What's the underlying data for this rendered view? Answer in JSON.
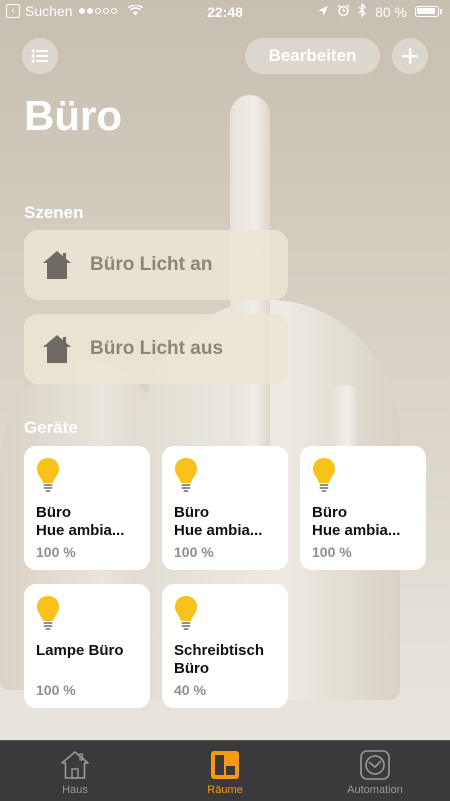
{
  "status_bar": {
    "back_label": "Suchen",
    "time": "22:48",
    "battery": "80 %"
  },
  "header": {
    "edit_label": "Bearbeiten",
    "title": "Büro"
  },
  "scenes": {
    "title": "Szenen",
    "items": [
      {
        "label": "Büro Licht an"
      },
      {
        "label": "Büro Licht aus"
      }
    ]
  },
  "devices": {
    "title": "Geräte",
    "items": [
      {
        "line1": "Büro",
        "line2": "Hue ambia...",
        "status": "100 %"
      },
      {
        "line1": "Büro",
        "line2": "Hue ambia...",
        "status": "100 %"
      },
      {
        "line1": "Büro",
        "line2": "Hue ambia...",
        "status": "100 %"
      },
      {
        "line1": "Lampe Büro",
        "line2": "",
        "status": "100 %"
      },
      {
        "line1": "Schreibtisch",
        "line2": "Büro",
        "status": "40 %"
      }
    ]
  },
  "tab_bar": {
    "tabs": [
      {
        "label": "Haus",
        "icon": "house-icon"
      },
      {
        "label": "Räume",
        "icon": "rooms-icon",
        "active": true
      },
      {
        "label": "Automation",
        "icon": "clock-icon"
      }
    ]
  },
  "colors": {
    "accent": "#f59a13",
    "bulb": "#f8c21a",
    "tab_bar_bg": "#3a3a3c"
  }
}
